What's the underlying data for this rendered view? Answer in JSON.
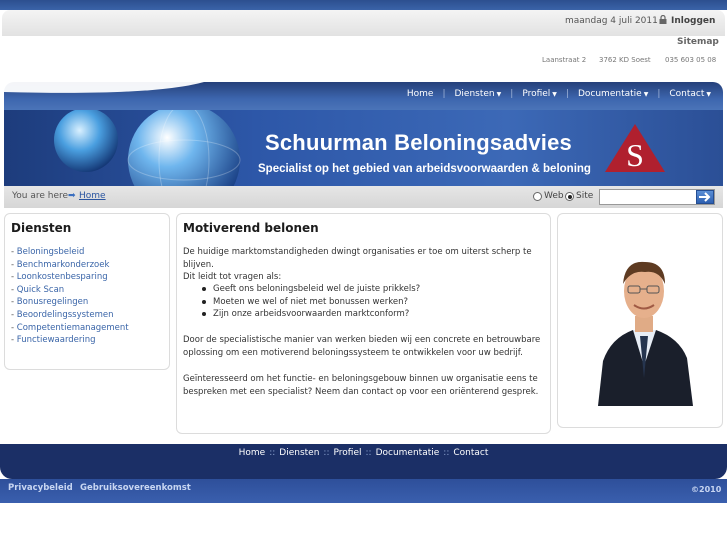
{
  "topbar": {
    "date": "maandag 4 juli 2011",
    "login_label": "Inloggen",
    "sitemap_label": "Sitemap",
    "address": [
      "Laanstraat 2",
      "3762 KD Soest",
      "035 603 05 08"
    ]
  },
  "nav": {
    "items": [
      {
        "label": "Home",
        "dropdown": false
      },
      {
        "label": "Diensten",
        "dropdown": true
      },
      {
        "label": "Profiel",
        "dropdown": true
      },
      {
        "label": "Documentatie",
        "dropdown": true
      },
      {
        "label": "Contact",
        "dropdown": true
      }
    ]
  },
  "banner": {
    "title": "Schuurman Beloningsadvies",
    "subtitle": "Specialist op het gebied van arbeidsvoorwaarden & beloning",
    "logo_letter": "S"
  },
  "breadcrumb": {
    "label": "You are here",
    "home": "Home"
  },
  "search": {
    "options": [
      "Web",
      "Site"
    ],
    "selected": "Site",
    "value": ""
  },
  "sidebar": {
    "title": "Diensten",
    "items": [
      "Beloningsbeleid",
      "Benchmarkonderzoek",
      "Loonkostenbesparing",
      "Quick Scan",
      "Bonusregelingen",
      "Beoordelingssystemen",
      "Competentiemanagement",
      "Functiewaardering"
    ]
  },
  "main": {
    "title": "Motiverend belonen",
    "paragraphs": [
      [
        "De huidige marktomstandigheden dwingt organisaties er toe om uiterst scherp te blijven.",
        "Dit leidt tot vragen als:"
      ],
      [
        "Door de specialistische manier van werken bieden wij een concrete en betrouwbare",
        "oplossing om een motiverend beloningssysteem te ontwikkelen voor uw bedrijf."
      ],
      [
        "Geïnteresseerd om het functie- en beloningsgebouw binnen uw organisatie eens te",
        "bespreken met een specialist? Neem dan contact op voor een oriënterend gesprek."
      ]
    ],
    "bullets": [
      "Geeft ons beloningsbeleid wel de juiste prikkels?",
      "Moeten we wel of niet met bonussen werken?",
      "Zijn onze arbeidsvoorwaarden marktconform?"
    ]
  },
  "footer": {
    "links": [
      "Home",
      "Diensten",
      "Profiel",
      "Documentatie",
      "Contact"
    ],
    "separator": "::",
    "privacy": "Privacybeleid",
    "terms": "Gebruiksovereenkomst",
    "copyright": "©2010"
  },
  "colors": {
    "nav_dark": "#25407a",
    "banner_blue": "#2d57a8",
    "link_blue": "#3a65a8",
    "logo_red": "#b0202e",
    "footer_navy": "#1b2f66"
  }
}
